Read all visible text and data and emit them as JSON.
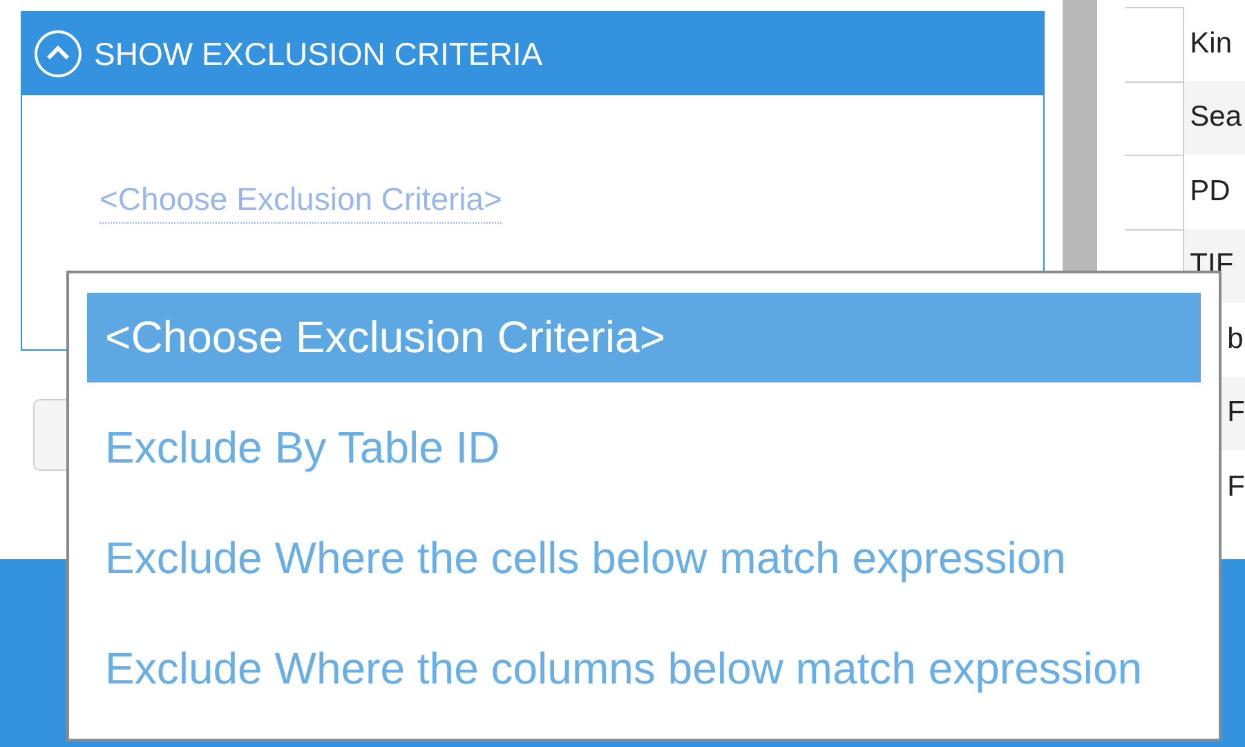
{
  "exclusion_panel": {
    "title": "SHOW EXCLUSION CRITERIA",
    "expanded": true,
    "criteria_link": "<Choose Exclusion Criteria>"
  },
  "table": {
    "rows": [
      {
        "column_2": "Kin"
      },
      {
        "column_2": "Sea"
      },
      {
        "column_2": "PD"
      },
      {
        "column_2": "TIF"
      },
      {
        "column_2": "b",
        "kind": "partial"
      },
      {
        "column_2": "F",
        "kind": "partial"
      },
      {
        "column_2": "F",
        "kind": "partial"
      }
    ]
  },
  "dropdown": {
    "options": [
      {
        "label": "<Choose Exclusion Criteria>",
        "selected": true
      },
      {
        "label": "Exclude By Table ID",
        "selected": false
      },
      {
        "label": "Exclude Where the cells below match expression",
        "selected": false
      },
      {
        "label": "Exclude Where the columns below match expression",
        "selected": false
      }
    ]
  }
}
